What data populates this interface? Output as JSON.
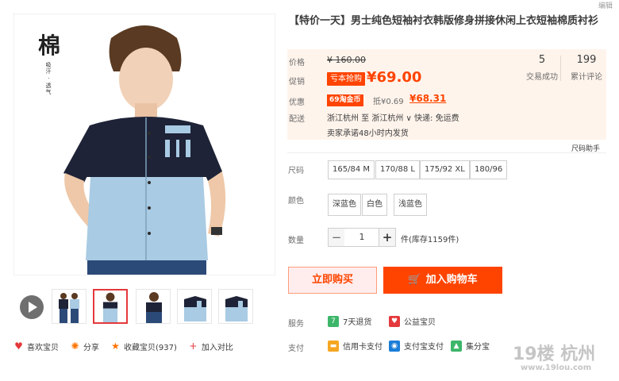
{
  "edit_label": "编辑",
  "calligraphy": {
    "char": "棉",
    "sub": "吸汗 · 透气"
  },
  "title": "【特价一天】男士纯色短袖衬衣韩版修身拼接休闲上衣短袖棉质衬衫",
  "price": {
    "label_price": "价格",
    "original": "¥ 160.00",
    "label_promo": "促销",
    "promo_tag": "亏本抢购",
    "promo_price": "¥69.00",
    "label_discount": "优惠",
    "coin_tag": "69淘金币",
    "deduct": "抵¥0.69",
    "final_price": "¥68.31",
    "label_delivery": "配送",
    "delivery": "浙江杭州  至  浙江杭州 ∨  快递: 免运费",
    "promise": "卖家承诺48小时内发货"
  },
  "stats": [
    {
      "num": "5",
      "label": "交易成功"
    },
    {
      "num": "199",
      "label": "累计评论"
    }
  ],
  "size_help": "尺码助手",
  "options": {
    "size_label": "尺码",
    "sizes": [
      "165/84 M",
      "170/88 L",
      "175/92 XL",
      "180/96"
    ],
    "color_label": "颜色",
    "colors": [
      "深蓝色",
      "白色",
      "浅蓝色"
    ]
  },
  "quantity": {
    "label": "数量",
    "minus": "−",
    "value": "1",
    "plus": "+",
    "stock": "件(库存1159件)"
  },
  "buttons": {
    "buy_now": "立即购买",
    "add_cart": "加入购物车"
  },
  "services": {
    "label": "服务",
    "items": [
      {
        "icon": "seven-days-icon",
        "text": "7天退货",
        "badge": "7",
        "color": "#3db66a"
      },
      {
        "icon": "charity-icon",
        "text": "公益宝贝",
        "badge": "♥",
        "color": "#e4393c"
      }
    ]
  },
  "payment": {
    "label": "支付",
    "items": [
      {
        "icon": "credit-card-icon",
        "text": "信用卡支付",
        "badge": "▬",
        "color": "#f5a623"
      },
      {
        "icon": "alipay-icon",
        "text": "支付宝支付",
        "badge": "◉",
        "color": "#1a7dd8"
      },
      {
        "icon": "jifen-icon",
        "text": "集分宝",
        "badge": "▲",
        "color": "#3db66a"
      }
    ]
  },
  "actions": [
    {
      "icon": "heart-icon",
      "glyph": "♥",
      "color": "#e4393c",
      "label": "喜欢宝贝"
    },
    {
      "icon": "share-icon",
      "glyph": "✺",
      "color": "#ff7300",
      "label": "分享"
    },
    {
      "icon": "star-icon",
      "glyph": "★",
      "color": "#ff7300",
      "label": "收藏宝贝(937)"
    },
    {
      "icon": "plus-icon",
      "glyph": "+",
      "color": "#e4393c",
      "label": "加入对比"
    }
  ],
  "watermark": {
    "main": "19楼 杭州",
    "sub": "www.19lou.com"
  },
  "colors": {
    "accent": "#ff4400",
    "price_bg": "#fff4ec"
  }
}
